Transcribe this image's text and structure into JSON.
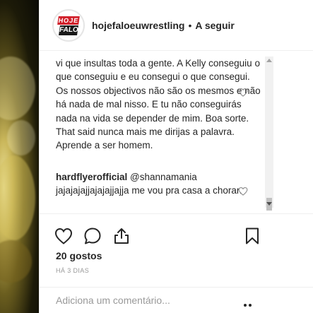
{
  "header": {
    "avatar_logo_top": "HOJE",
    "avatar_logo_bottom": "FALO",
    "username": "hojefaloeuwrestling",
    "separator": "•",
    "follow_label": "A seguir"
  },
  "comments": [
    {
      "username": "",
      "text": "vi que insultas toda a gente. A Kelly conseguiu o que conseguiu e eu consegui o que consegui. Os nossos objectivos não são os mesmos e não há nada de mal nisso. E tu não conseguirás nada na vida se depender de mim. Boa sorte. That said nunca mais me dirijas a palavra. Aprende a ser homem."
    },
    {
      "username": "hardflyerofficial",
      "text": "@shannamania jajajajajjajajajjajja me vou pra casa a chorar."
    }
  ],
  "icons": {
    "like": "heart-icon",
    "comment": "comment-icon",
    "share": "share-icon",
    "save": "bookmark-icon",
    "comment_like": "heart-icon",
    "options": "more-options-icon"
  },
  "likes_text": "20 gostos",
  "time_ago": "HÁ 3 DIAS",
  "add_comment": {
    "placeholder": "Adiciona um comentário..."
  }
}
